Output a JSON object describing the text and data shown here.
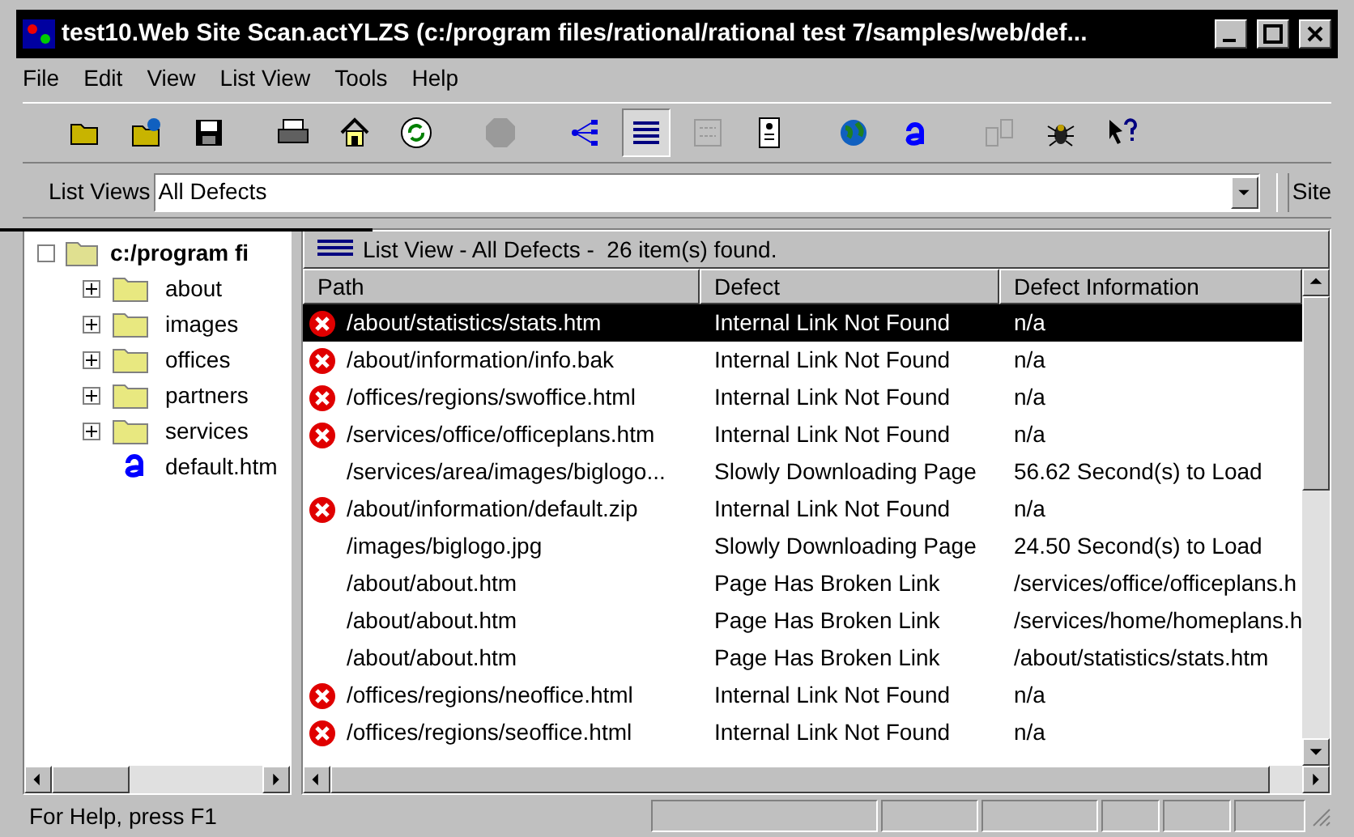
{
  "window": {
    "title": "test10.Web Site Scan.actYLZS (c:/program files/rational/rational test 7/samples/web/def..."
  },
  "menu": [
    "File",
    "Edit",
    "View",
    "List View",
    "Tools",
    "Help"
  ],
  "toolbar": [
    {
      "kind": "open",
      "pressed": false,
      "disabled": false
    },
    {
      "kind": "open-web",
      "pressed": false,
      "disabled": false
    },
    {
      "kind": "save",
      "pressed": false,
      "disabled": false
    },
    {
      "kind": "print",
      "pressed": false,
      "disabled": false
    },
    {
      "kind": "home",
      "pressed": false,
      "disabled": false
    },
    {
      "kind": "refresh",
      "pressed": false,
      "disabled": false
    },
    {
      "kind": "stop",
      "pressed": false,
      "disabled": true
    },
    {
      "kind": "tree",
      "pressed": false,
      "disabled": false
    },
    {
      "kind": "list",
      "pressed": true,
      "disabled": false
    },
    {
      "kind": "html",
      "pressed": false,
      "disabled": true
    },
    {
      "kind": "document",
      "pressed": false,
      "disabled": false
    },
    {
      "kind": "globe",
      "pressed": false,
      "disabled": false
    },
    {
      "kind": "letter",
      "pressed": false,
      "disabled": false
    },
    {
      "kind": "compare",
      "pressed": false,
      "disabled": true
    },
    {
      "kind": "bug",
      "pressed": false,
      "disabled": false
    },
    {
      "kind": "help",
      "pressed": false,
      "disabled": false
    }
  ],
  "list_views": {
    "label": "List Views",
    "value": "All Defects",
    "site_label": "Site"
  },
  "tree": {
    "root": "c:/program fi",
    "children": [
      {
        "label": "about",
        "kind": "folder"
      },
      {
        "label": "images",
        "kind": "folder"
      },
      {
        "label": "offices",
        "kind": "folder"
      },
      {
        "label": "partners",
        "kind": "folder"
      },
      {
        "label": "services",
        "kind": "folder"
      },
      {
        "label": "default.htm",
        "kind": "page"
      }
    ]
  },
  "list": {
    "title": "List View - All Defects -  26 item(s) found.",
    "columns": [
      "Path",
      "Defect",
      "Defect Information"
    ],
    "rows": [
      {
        "error": true,
        "selected": true,
        "cells": [
          "/about/statistics/stats.htm",
          "Internal Link Not Found",
          "n/a"
        ]
      },
      {
        "error": true,
        "selected": false,
        "cells": [
          "/about/information/info.bak",
          "Internal Link Not Found",
          "n/a"
        ]
      },
      {
        "error": true,
        "selected": false,
        "cells": [
          "/offices/regions/swoffice.html",
          "Internal Link Not Found",
          "n/a"
        ]
      },
      {
        "error": true,
        "selected": false,
        "cells": [
          "/services/office/officeplans.htm",
          "Internal Link Not Found",
          "n/a"
        ]
      },
      {
        "error": false,
        "selected": false,
        "cells": [
          "/services/area/images/biglogo...",
          "Slowly Downloading Page",
          "56.62 Second(s) to Load"
        ]
      },
      {
        "error": true,
        "selected": false,
        "cells": [
          "/about/information/default.zip",
          "Internal Link Not Found",
          "n/a"
        ]
      },
      {
        "error": false,
        "selected": false,
        "cells": [
          "/images/biglogo.jpg",
          "Slowly Downloading Page",
          "24.50 Second(s) to Load"
        ]
      },
      {
        "error": false,
        "selected": false,
        "cells": [
          "/about/about.htm",
          "Page Has Broken Link",
          "/services/office/officeplans.h"
        ]
      },
      {
        "error": false,
        "selected": false,
        "cells": [
          "/about/about.htm",
          "Page Has Broken Link",
          "/services/home/homeplans.h"
        ]
      },
      {
        "error": false,
        "selected": false,
        "cells": [
          "/about/about.htm",
          "Page Has Broken Link",
          "/about/statistics/stats.htm"
        ]
      },
      {
        "error": true,
        "selected": false,
        "cells": [
          "/offices/regions/neoffice.html",
          "Internal Link Not Found",
          "n/a"
        ]
      },
      {
        "error": true,
        "selected": false,
        "cells": [
          "/offices/regions/seoffice.html",
          "Internal Link Not Found",
          "n/a"
        ]
      }
    ]
  },
  "status_bar": {
    "text": "For Help, press F1"
  }
}
